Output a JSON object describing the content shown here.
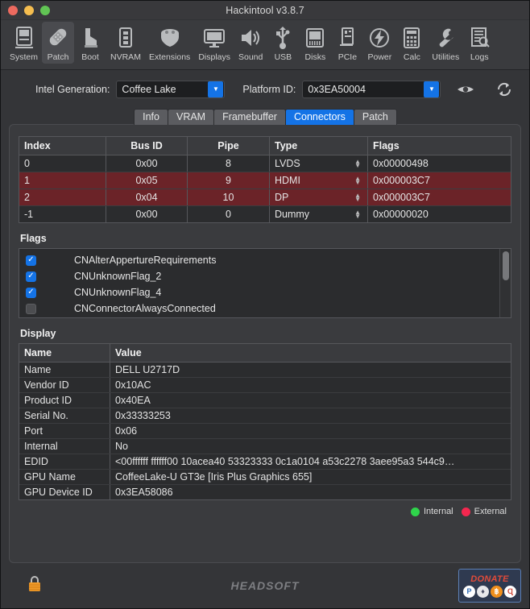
{
  "window": {
    "title": "Hackintool v3.8.7",
    "traffic_lights": [
      "close",
      "minimize",
      "maximize"
    ]
  },
  "toolbar": {
    "items": [
      {
        "label": "System",
        "icon": "computer-icon",
        "selected": false
      },
      {
        "label": "Patch",
        "icon": "bandage-icon",
        "selected": true
      },
      {
        "label": "Boot",
        "icon": "boot-icon",
        "selected": false
      },
      {
        "label": "NVRAM",
        "icon": "memory-icon",
        "selected": false
      },
      {
        "label": "Extensions",
        "icon": "kext-icon",
        "selected": false
      },
      {
        "label": "Displays",
        "icon": "monitor-icon",
        "selected": false
      },
      {
        "label": "Sound",
        "icon": "speaker-icon",
        "selected": false
      },
      {
        "label": "USB",
        "icon": "usb-icon",
        "selected": false
      },
      {
        "label": "Disks",
        "icon": "disk-icon",
        "selected": false
      },
      {
        "label": "PCIe",
        "icon": "pcie-card-icon",
        "selected": false
      },
      {
        "label": "Power",
        "icon": "power-bolt-icon",
        "selected": false
      },
      {
        "label": "Calc",
        "icon": "calculator-icon",
        "selected": false
      },
      {
        "label": "Utilities",
        "icon": "wrench-icon",
        "selected": false
      },
      {
        "label": "Logs",
        "icon": "log-search-icon",
        "selected": false
      }
    ]
  },
  "controls": {
    "intel_generation_label": "Intel Generation:",
    "intel_generation_value": "Coffee Lake",
    "platform_id_label": "Platform ID:",
    "platform_id_value": "0x3EA50004",
    "eye_icon": "eye-icon",
    "refresh_icon": "refresh-icon"
  },
  "tabs": [
    {
      "label": "Info",
      "active": false
    },
    {
      "label": "VRAM",
      "active": false
    },
    {
      "label": "Framebuffer",
      "active": false
    },
    {
      "label": "Connectors",
      "active": true
    },
    {
      "label": "Patch",
      "active": false
    }
  ],
  "connectors": {
    "headers": [
      "Index",
      "Bus ID",
      "Pipe",
      "Type",
      "Flags"
    ],
    "rows": [
      {
        "index": "0",
        "bus": "0x00",
        "pipe": "8",
        "type": "LVDS",
        "flags": "0x00000498",
        "highlight": false
      },
      {
        "index": "1",
        "bus": "0x05",
        "pipe": "9",
        "type": "HDMI",
        "flags": "0x000003C7",
        "highlight": true
      },
      {
        "index": "2",
        "bus": "0x04",
        "pipe": "10",
        "type": "DP",
        "flags": "0x000003C7",
        "highlight": true
      },
      {
        "index": "-1",
        "bus": "0x00",
        "pipe": "0",
        "type": "Dummy",
        "flags": "0x00000020",
        "highlight": false
      }
    ]
  },
  "flags": {
    "title": "Flags",
    "items": [
      {
        "label": "CNAlterAppertureRequirements",
        "checked": true
      },
      {
        "label": "CNUnknownFlag_2",
        "checked": true
      },
      {
        "label": "CNUnknownFlag_4",
        "checked": true
      },
      {
        "label": "CNConnectorAlwaysConnected",
        "checked": false
      }
    ]
  },
  "display": {
    "title": "Display",
    "headers": [
      "Name",
      "Value"
    ],
    "rows": [
      {
        "name": "Name",
        "value": "DELL U2717D"
      },
      {
        "name": "Vendor ID",
        "value": "0x10AC"
      },
      {
        "name": "Product ID",
        "value": "0x40EA"
      },
      {
        "name": "Serial No.",
        "value": "0x33333253"
      },
      {
        "name": "Port",
        "value": "0x06"
      },
      {
        "name": "Internal",
        "value": "No"
      },
      {
        "name": "EDID",
        "value": "<00ffffff ffffff00 10acea40 53323333 0c1a0104 a53c2278 3aee95a3 544c9…"
      },
      {
        "name": "GPU Name",
        "value": "CoffeeLake-U GT3e [Iris Plus Graphics 655]"
      },
      {
        "name": "GPU Device ID",
        "value": "0x3EA58086"
      }
    ]
  },
  "legend": [
    {
      "label": "Internal",
      "color": "#2fd44b"
    },
    {
      "label": "External",
      "color": "#f4274f"
    }
  ],
  "statusbar": {
    "lock_icon": "padlock-locked-icon",
    "brand": "HEADSOFT",
    "donate_label": "DONATE",
    "donate_methods": [
      {
        "name": "paypal-icon",
        "glyph": "P"
      },
      {
        "name": "ethereum-icon",
        "glyph": "♦"
      },
      {
        "name": "bitcoin-icon",
        "glyph": "Ƀ"
      },
      {
        "name": "monero-icon",
        "glyph": "Ɗ"
      }
    ]
  },
  "colors": {
    "accent": "#1473e6",
    "row_highlight": "#6b2328",
    "window_bg": "#343538"
  }
}
